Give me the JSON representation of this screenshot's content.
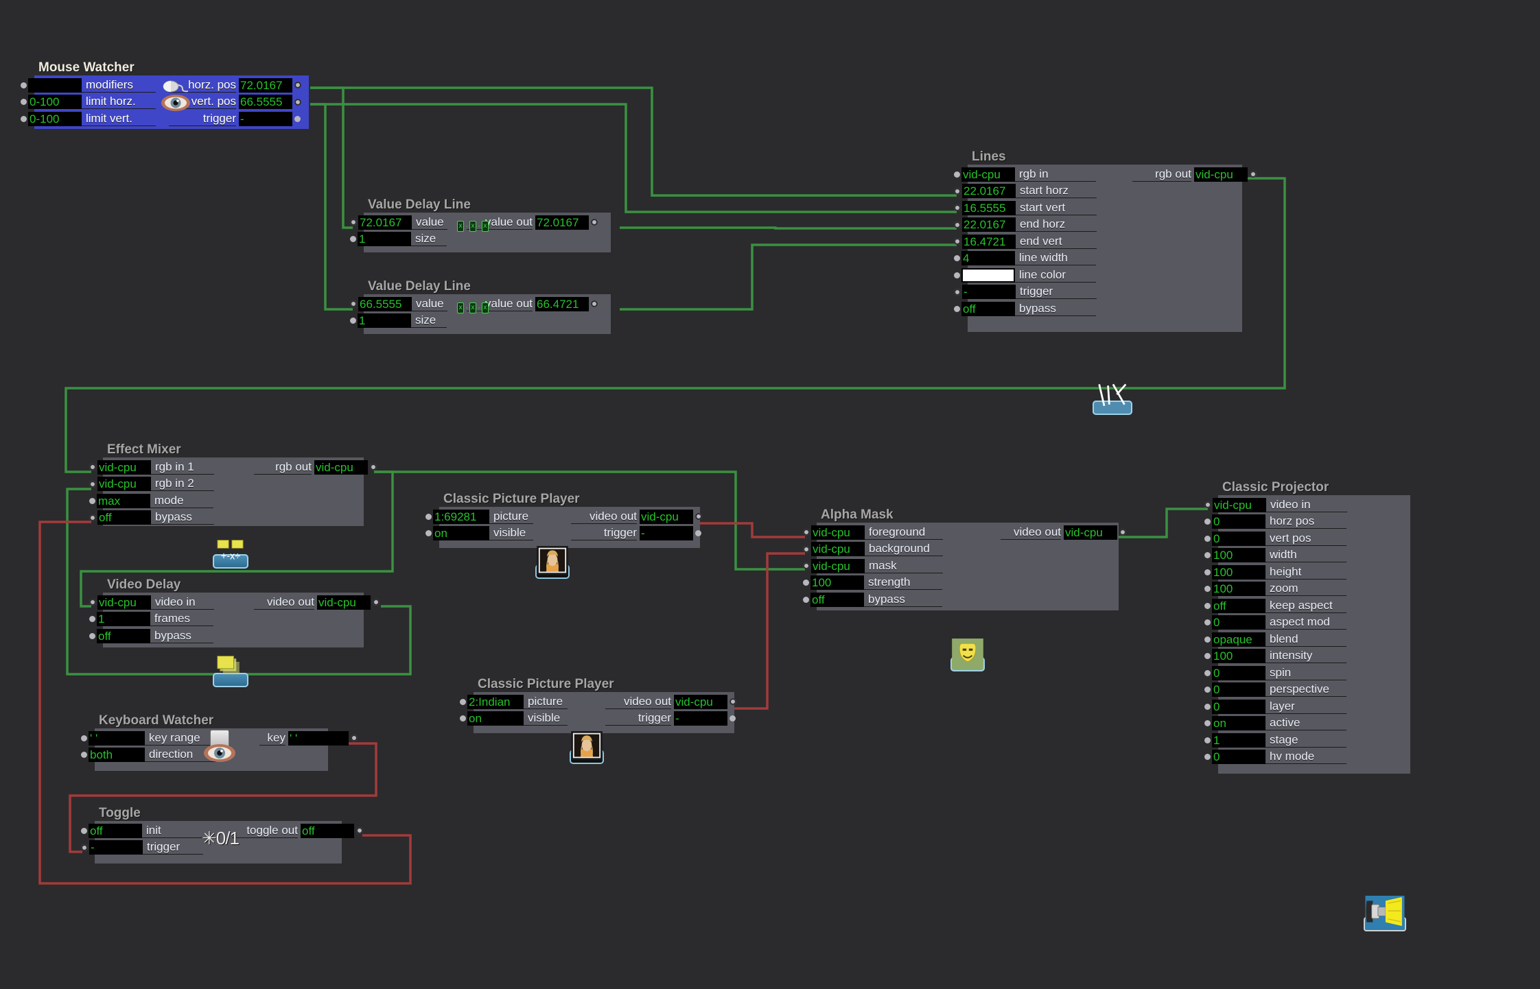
{
  "app": {
    "background_color": "#2b2b2d",
    "node_body_color": "#585860",
    "selected_node_color": "#3f46c8",
    "value_text_color": "#27c12b",
    "video_wire_color": "#3a9141",
    "trigger_wire_color": "#a33b3b"
  },
  "nodes": {
    "mouse_watcher": {
      "title": "Mouse Watcher",
      "icons": [
        "mouse-icon",
        "eye-icon"
      ],
      "inputs": [
        {
          "label": "modifiers",
          "value": ""
        },
        {
          "label": "limit horz.",
          "value": "0-100"
        },
        {
          "label": "limit vert.",
          "value": "0-100"
        }
      ],
      "outputs": [
        {
          "label": "horz. pos",
          "value": "72.0167"
        },
        {
          "label": "vert. pos",
          "value": "66.5555"
        },
        {
          "label": "trigger",
          "value": "-"
        }
      ]
    },
    "value_delay_line_1": {
      "title": "Value Delay Line",
      "icon": "value-delay-icon",
      "inputs": [
        {
          "label": "value",
          "value": "72.0167"
        },
        {
          "label": "size",
          "value": "1"
        }
      ],
      "outputs": [
        {
          "label": "value out",
          "value": "72.0167"
        }
      ]
    },
    "value_delay_line_2": {
      "title": "Value Delay Line",
      "icon": "value-delay-icon",
      "inputs": [
        {
          "label": "value",
          "value": "66.5555"
        },
        {
          "label": "size",
          "value": "1"
        }
      ],
      "outputs": [
        {
          "label": "value out",
          "value": "66.4721"
        }
      ]
    },
    "lines": {
      "title": "Lines",
      "icon": "lines-icon",
      "inputs": [
        {
          "label": "rgb in",
          "value": "vid-cpu"
        },
        {
          "label": "start horz",
          "value": "22.0167"
        },
        {
          "label": "start vert",
          "value": "16.5555"
        },
        {
          "label": "end horz",
          "value": "22.0167"
        },
        {
          "label": "end vert",
          "value": "16.4721"
        },
        {
          "label": "line width",
          "value": "4"
        },
        {
          "label": "line color",
          "value": "",
          "swatch": "#ffffff"
        },
        {
          "label": "trigger",
          "value": "-"
        },
        {
          "label": "bypass",
          "value": "off"
        }
      ],
      "outputs": [
        {
          "label": "rgb out",
          "value": "vid-cpu"
        }
      ]
    },
    "effect_mixer": {
      "title": "Effect Mixer",
      "icon": "mixer-icon",
      "inputs": [
        {
          "label": "rgb in 1",
          "value": "vid-cpu"
        },
        {
          "label": "rgb in 2",
          "value": "vid-cpu"
        },
        {
          "label": "mode",
          "value": "max"
        },
        {
          "label": "bypass",
          "value": "off"
        }
      ],
      "outputs": [
        {
          "label": "rgb out",
          "value": "vid-cpu"
        }
      ]
    },
    "video_delay": {
      "title": "Video Delay",
      "icon": "video-delay-icon",
      "inputs": [
        {
          "label": "video in",
          "value": "vid-cpu"
        },
        {
          "label": "frames",
          "value": "1"
        },
        {
          "label": "bypass",
          "value": "off"
        }
      ],
      "outputs": [
        {
          "label": "video out",
          "value": "vid-cpu"
        }
      ]
    },
    "picture_player_1": {
      "title": "Classic Picture Player",
      "icon": "picture-thumbnail-icon",
      "inputs": [
        {
          "label": "picture",
          "value": "1:69281"
        },
        {
          "label": "visible",
          "value": "on"
        }
      ],
      "outputs": [
        {
          "label": "video out",
          "value": "vid-cpu"
        },
        {
          "label": "trigger",
          "value": "-"
        }
      ]
    },
    "picture_player_2": {
      "title": "Classic Picture Player",
      "icon": "picture-thumbnail-icon",
      "inputs": [
        {
          "label": "picture",
          "value": "2:Indian"
        },
        {
          "label": "visible",
          "value": "on"
        }
      ],
      "outputs": [
        {
          "label": "video out",
          "value": "vid-cpu"
        },
        {
          "label": "trigger",
          "value": "-"
        }
      ]
    },
    "alpha_mask": {
      "title": "Alpha Mask",
      "icon": "mask-icon",
      "inputs": [
        {
          "label": "foreground",
          "value": "vid-cpu"
        },
        {
          "label": "background",
          "value": "vid-cpu"
        },
        {
          "label": "mask",
          "value": "vid-cpu"
        },
        {
          "label": "strength",
          "value": "100"
        },
        {
          "label": "bypass",
          "value": "off"
        }
      ],
      "outputs": [
        {
          "label": "video out",
          "value": "vid-cpu"
        }
      ]
    },
    "classic_projector": {
      "title": "Classic Projector",
      "icon": "projector-icon",
      "inputs": [
        {
          "label": "video in",
          "value": "vid-cpu"
        },
        {
          "label": "horz pos",
          "value": "0"
        },
        {
          "label": "vert pos",
          "value": "0"
        },
        {
          "label": "width",
          "value": "100"
        },
        {
          "label": "height",
          "value": "100"
        },
        {
          "label": "zoom",
          "value": "100"
        },
        {
          "label": "keep aspect",
          "value": "off"
        },
        {
          "label": "aspect mod",
          "value": "0"
        },
        {
          "label": "blend",
          "value": "opaque"
        },
        {
          "label": "intensity",
          "value": "100"
        },
        {
          "label": "spin",
          "value": "0"
        },
        {
          "label": "perspective",
          "value": "0"
        },
        {
          "label": "layer",
          "value": "0"
        },
        {
          "label": "active",
          "value": "on"
        },
        {
          "label": "stage",
          "value": "1"
        },
        {
          "label": "hv mode",
          "value": "0"
        }
      ],
      "outputs": []
    },
    "keyboard_watcher": {
      "title": "Keyboard Watcher",
      "icons": [
        "key-icon",
        "eye-icon"
      ],
      "inputs": [
        {
          "label": "key range",
          "value": "' '"
        },
        {
          "label": "direction",
          "value": "both"
        }
      ],
      "outputs": [
        {
          "label": "key",
          "value": "' '"
        }
      ]
    },
    "toggle": {
      "title": "Toggle",
      "icon": "toggle-icon",
      "icon_glyph": "✳0/1",
      "inputs": [
        {
          "label": "init",
          "value": "off"
        },
        {
          "label": "trigger",
          "value": "-"
        }
      ],
      "outputs": [
        {
          "label": "toggle out",
          "value": "off"
        }
      ]
    }
  }
}
